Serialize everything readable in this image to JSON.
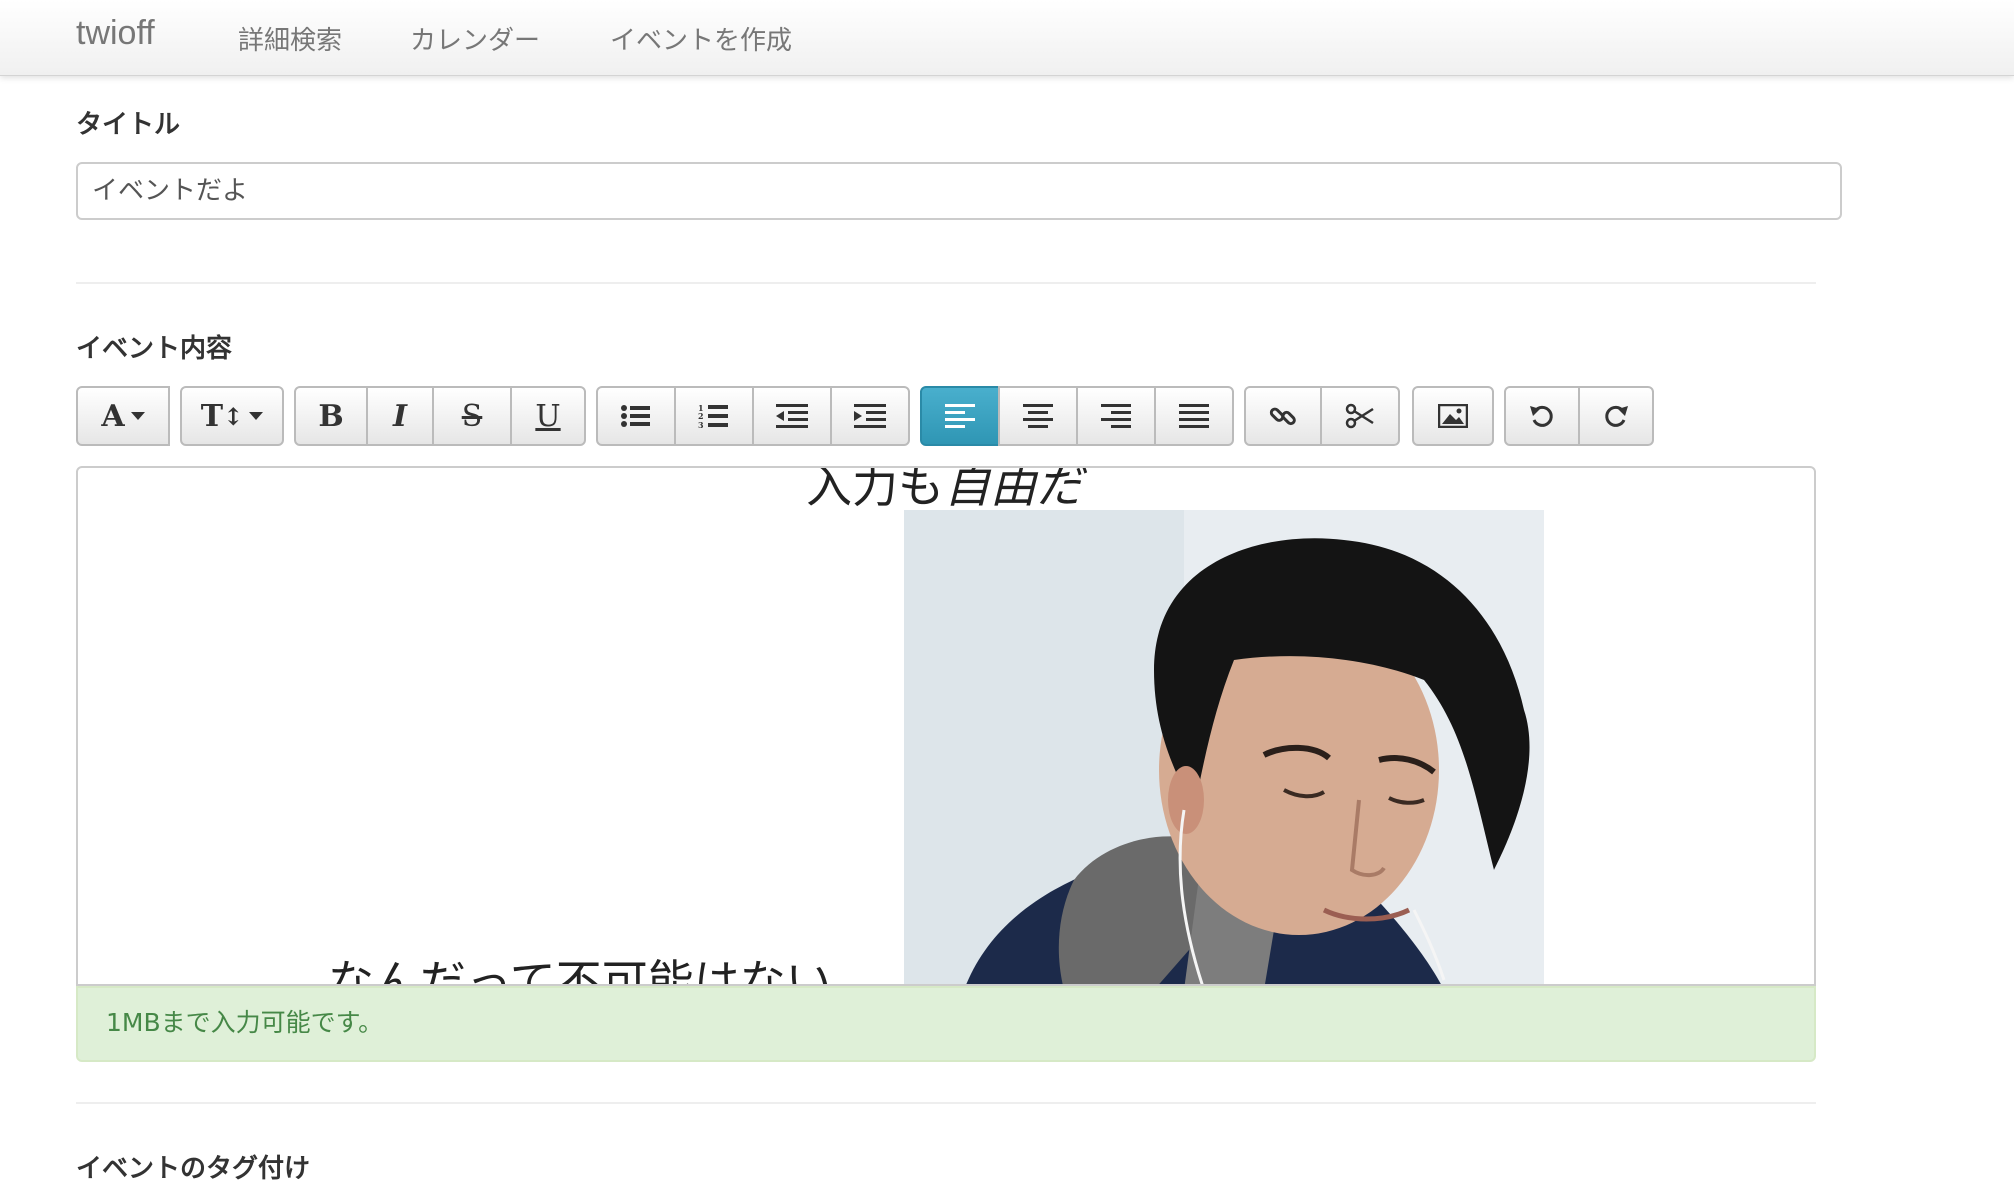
{
  "navbar": {
    "brand": "twioff",
    "links": [
      "詳細検索",
      "カレンダー",
      "イベントを作成"
    ]
  },
  "title_section": {
    "label": "タイトル",
    "value": "イベントだよ"
  },
  "content_section": {
    "label": "イベント内容",
    "toolbar": {
      "font": "A",
      "font_size": "T",
      "bold": "B",
      "italic": "I",
      "strikethrough": "S",
      "underline": "U",
      "active_button": "align-left"
    },
    "editor": {
      "line1_normal": "入力も",
      "line1_italic": "自由だ",
      "line2": "なんだって不可能はない"
    },
    "alert": "1MBまで入力可能です。"
  },
  "tags_section": {
    "label": "イベントのタグ付け"
  },
  "colors": {
    "accent": "#2f96b4",
    "alert_bg": "#dff0d8",
    "alert_text": "#468847"
  }
}
